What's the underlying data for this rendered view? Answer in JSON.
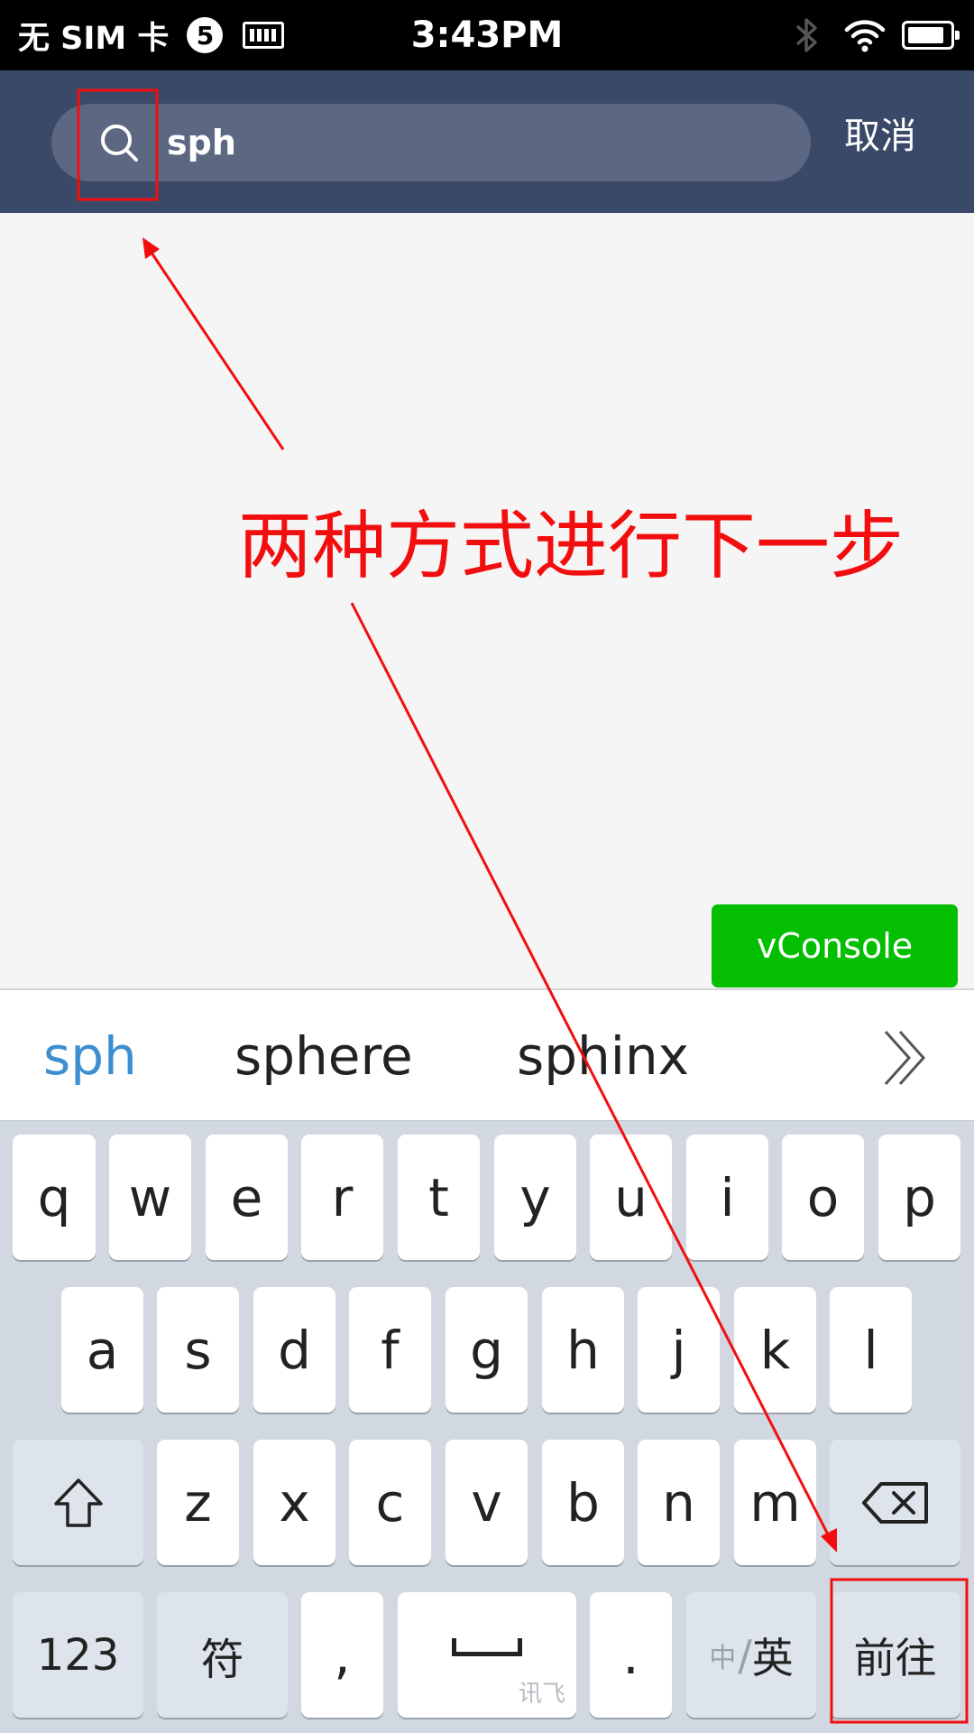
{
  "status_bar": {
    "carrier": "无 SIM 卡",
    "notification_count": "5",
    "time": "3:43PM",
    "battery_level": 0.85
  },
  "search": {
    "query": "sph",
    "cancel_label": "取消"
  },
  "annotation": {
    "text": "两种方式进行下一步",
    "color": "#f20e0e"
  },
  "vconsole": {
    "label": "vConsole",
    "color": "#04be02"
  },
  "candidates": [
    "sph",
    "sphere",
    "sphinx"
  ],
  "keyboard": {
    "row1": [
      "q",
      "w",
      "e",
      "r",
      "t",
      "y",
      "u",
      "i",
      "o",
      "p"
    ],
    "row2": [
      "a",
      "s",
      "d",
      "f",
      "g",
      "h",
      "j",
      "k",
      "l"
    ],
    "row3": [
      "z",
      "x",
      "c",
      "v",
      "b",
      "n",
      "m"
    ],
    "numbers_label": "123",
    "symbols_label": "符",
    "comma_label": ",",
    "space_brand": "讯飞",
    "period_label": ".",
    "lang_zh": "中",
    "lang_en": "英",
    "go_label": "前往"
  },
  "colors": {
    "header_bg": "#3b4968",
    "search_bg": "#5c6782",
    "keyboard_bg": "#d2d8e1",
    "selected_candidate": "#3d8fd1"
  },
  "icons": [
    "bluetooth-icon",
    "wifi-icon",
    "battery-icon",
    "search-icon",
    "shift-icon",
    "backspace-icon",
    "double-chevron-right-icon"
  ]
}
